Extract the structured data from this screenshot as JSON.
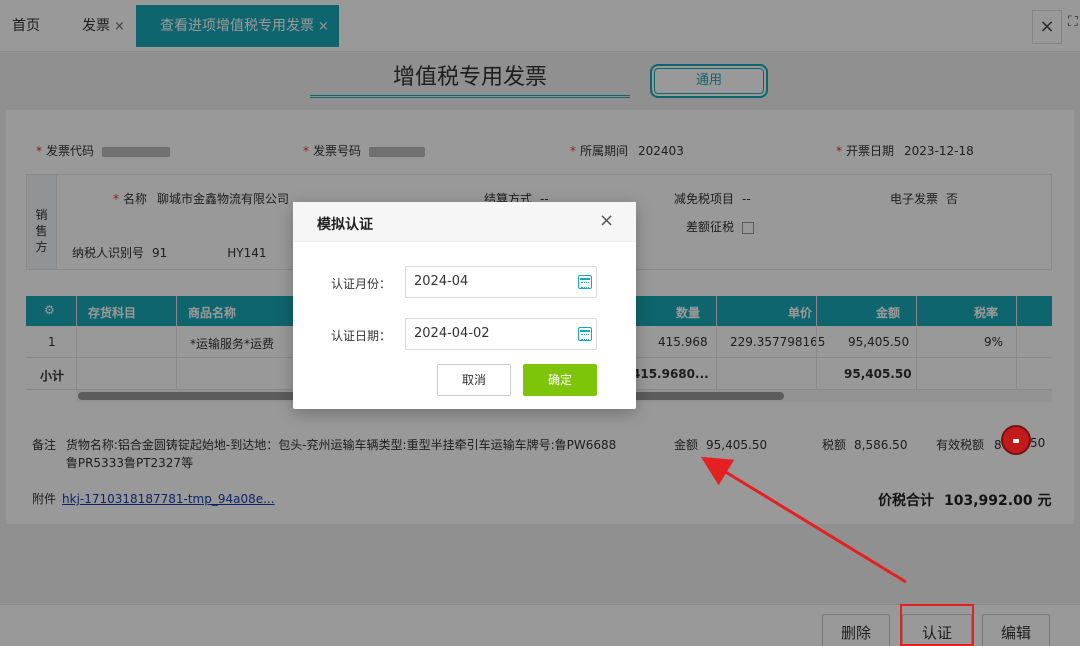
{
  "tabs": {
    "home": "首页",
    "invoice": "发票",
    "active": "查看进项增值税专用发票",
    "close_glyph": "×"
  },
  "invoice": {
    "title": "增值税专用发票",
    "type_button": "通用",
    "code_label": "发票代码",
    "number_label": "发票号码",
    "period_label": "所属期间",
    "period_value": "202403",
    "date_label": "开票日期",
    "date_value": "2023-12-18"
  },
  "seller": {
    "side_label": "销\n售\n方",
    "name_label": "名称",
    "name_value": "聊城市金鑫物流有限公司",
    "taxid_label": "纳税人识别号",
    "taxid_value": "91     HY141",
    "settle_label": "结算方式",
    "settle_value": "--",
    "exempt_label": "减免税项目",
    "exempt_value": "--",
    "diff_label": "差额征税",
    "einvoice_label": "电子发票",
    "einvoice_value": "否"
  },
  "grid": {
    "headers": [
      "存货科目",
      "商品名称",
      "数量",
      "单价",
      "金额",
      "税率"
    ],
    "row": {
      "index": "1",
      "name": "*运输服务*运费",
      "qty": "415.968",
      "price": "229.357798165",
      "amount": "95,405.50",
      "rate": "9%"
    },
    "subtotal": {
      "label": "小计",
      "qty": "415.9680...",
      "amount": "95,405.50"
    }
  },
  "remark": {
    "label": "备注",
    "text": "货物名称:铝合金圆铸锭起始地-到达地：包头-兖州运输车辆类型:重型半挂牵引车运输车牌号:鲁PW6688鲁PR5333鲁PT2327等"
  },
  "amounts": {
    "amount_label": "金额",
    "amount_value": "95,405.50",
    "tax_label": "税额",
    "tax_value": "8,586.50",
    "valid_tax_label": "有效税额",
    "valid_tax_value": "8",
    "valid_tax_tail": "50"
  },
  "attachment": {
    "label": "附件",
    "link": "hkj-1710318187781-tmp_94a08e..."
  },
  "total": {
    "label": "价税合计",
    "value": "103,992.00 元"
  },
  "footer": {
    "delete": "删除",
    "certify": "认证",
    "edit": "编辑"
  },
  "modal": {
    "title": "模拟认证",
    "close": "×",
    "month_label": "认证月份：",
    "month_value": "2024-04",
    "date_label": "认证日期：",
    "date_value": "2024-04-02",
    "cancel": "取消",
    "confirm": "确定"
  },
  "colors": {
    "accent": "#1aa8b8",
    "confirm_green": "#7ec50a",
    "annotation_red": "#e52020"
  }
}
